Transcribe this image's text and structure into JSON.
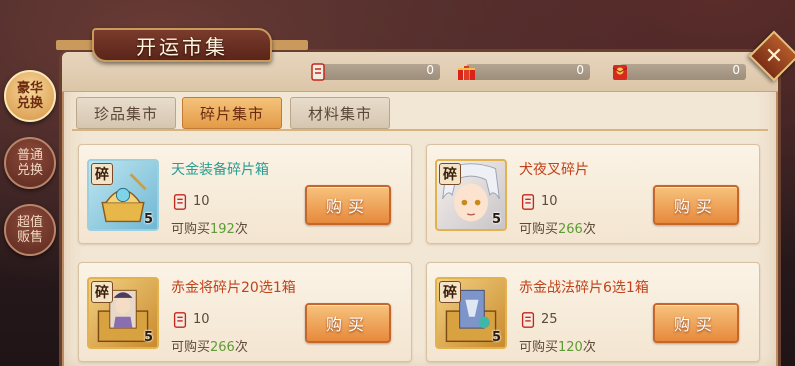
{
  "title": "开运市集",
  "close_icon": "close-x-icon",
  "currencies": [
    {
      "icon": "scroll-ticket-icon",
      "value": "0"
    },
    {
      "icon": "firecracker-icon",
      "value": "0"
    },
    {
      "icon": "red-packet-icon",
      "value": "0"
    }
  ],
  "side_tabs": [
    {
      "label": "豪华兑换",
      "active": true
    },
    {
      "label": "普通兑换",
      "active": false
    },
    {
      "label": "超值贩售",
      "active": false
    }
  ],
  "tabs": [
    {
      "label": "珍品集市",
      "active": false
    },
    {
      "label": "碎片集市",
      "active": true
    },
    {
      "label": "材料集市",
      "active": false
    }
  ],
  "items": [
    {
      "name": "天金装备碎片箱",
      "badge": "碎",
      "count": "5",
      "price": "10",
      "limit_prefix": "可购买",
      "limit_num": "192",
      "limit_suffix": "次",
      "buy_label": "购买"
    },
    {
      "name": "犬夜叉碎片",
      "badge": "碎",
      "count": "5",
      "price": "10",
      "limit_prefix": "可购买",
      "limit_num": "266",
      "limit_suffix": "次",
      "buy_label": "购买"
    },
    {
      "name": "赤金将碎片20选1箱",
      "badge": "碎",
      "count": "5",
      "price": "10",
      "limit_prefix": "可购买",
      "limit_num": "266",
      "limit_suffix": "次",
      "buy_label": "购买"
    },
    {
      "name": "赤金战法碎片6选1箱",
      "badge": "碎",
      "count": "5",
      "price": "25",
      "limit_prefix": "可购买",
      "limit_num": "120",
      "limit_suffix": "次",
      "buy_label": "购买"
    }
  ],
  "colors": {
    "panel": "#f2e6d4",
    "accent": "#e68a3c",
    "name_red": "#c0421a",
    "name_teal": "#2a9c93",
    "limit_green": "#5d9c32"
  }
}
